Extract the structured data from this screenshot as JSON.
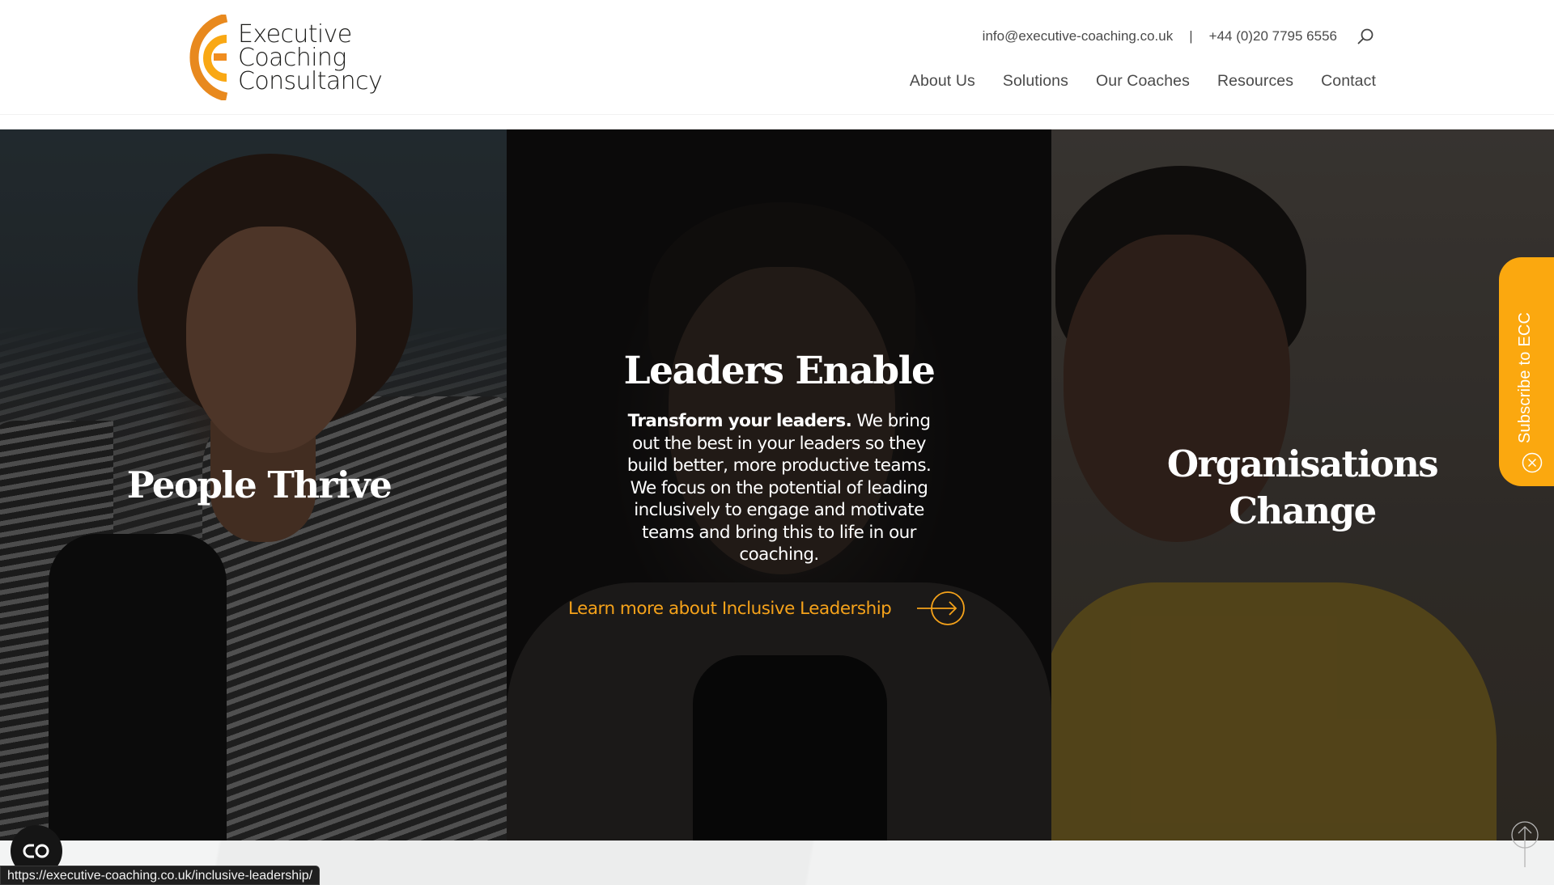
{
  "brand": {
    "name_lines": [
      "Executive",
      "Coaching",
      "Consultancy"
    ],
    "colors": {
      "outer_arc": "#E8891E",
      "inner_arc": "#F9A814",
      "accent": "#F5A21A",
      "subscribe_bg": "#FBA80F"
    }
  },
  "topbar": {
    "email": "info@executive-coaching.co.uk",
    "separator": "|",
    "phone": "+44 (0)20 7795 6556",
    "search_icon": "search-icon"
  },
  "nav": {
    "items": [
      {
        "label": "About Us"
      },
      {
        "label": "Solutions"
      },
      {
        "label": "Our Coaches"
      },
      {
        "label": "Resources"
      },
      {
        "label": "Contact"
      }
    ]
  },
  "hero": {
    "panels": [
      {
        "heading": "People Thrive"
      },
      {
        "heading": "Leaders Enable",
        "description_bold": "Transform your leaders.",
        "description_rest": " We bring out the best in your leaders so they build better, more productive teams. We focus on the potential of leading inclusively to engage and motivate teams and bring this to life in our coaching.",
        "link_label": "Learn more about Inclusive Leadership",
        "link_icon": "arrow-circle-right-icon"
      },
      {
        "heading_lines": [
          "Organisations",
          "Change"
        ]
      }
    ]
  },
  "subscribe": {
    "label": "Subscribe to ECC",
    "close_icon": "close-circle-icon"
  },
  "scroll_top": {
    "icon": "arrow-up-circle-icon"
  },
  "cookie": {
    "icon": "cookie-consent-icon"
  },
  "status_bar": {
    "url": "https://executive-coaching.co.uk/inclusive-leadership/"
  }
}
